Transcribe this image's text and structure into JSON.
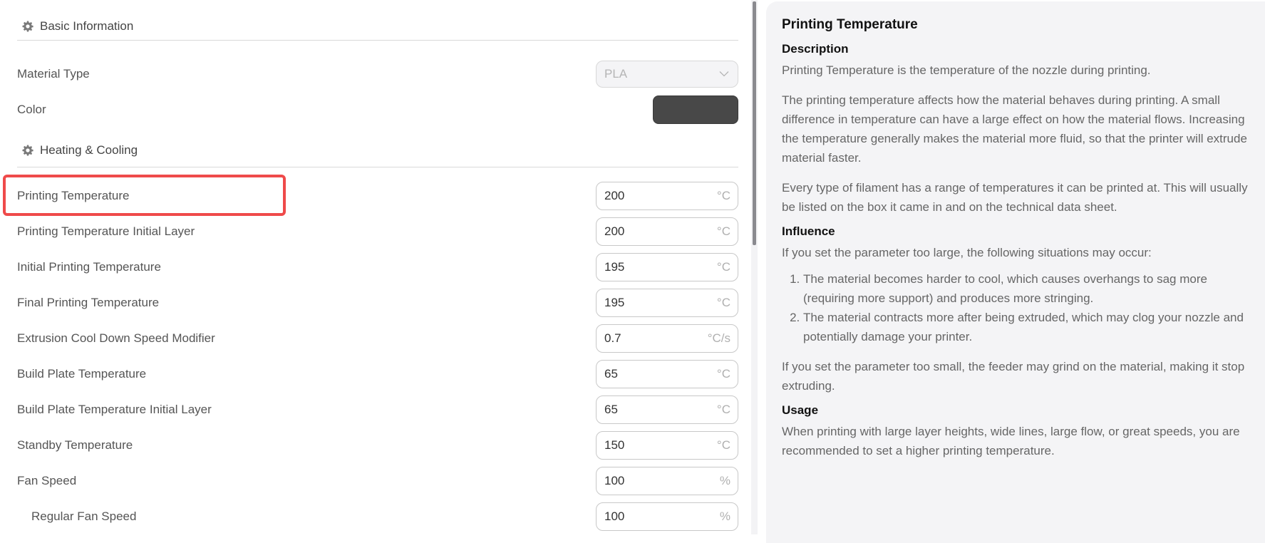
{
  "sections": [
    {
      "title": "Basic Information",
      "icon": "gear-icon"
    },
    {
      "title": "Heating & Cooling",
      "icon": "gear-icon"
    }
  ],
  "basic": {
    "material_type": {
      "label": "Material Type",
      "value": "PLA",
      "disabled": true
    },
    "color": {
      "label": "Color",
      "value": "#484848"
    }
  },
  "settings": [
    {
      "label": "Printing Temperature",
      "value": "200",
      "unit": "°C",
      "highlighted": true
    },
    {
      "label": "Printing Temperature Initial Layer",
      "value": "200",
      "unit": "°C"
    },
    {
      "label": "Initial Printing Temperature",
      "value": "195",
      "unit": "°C"
    },
    {
      "label": "Final Printing Temperature",
      "value": "195",
      "unit": "°C"
    },
    {
      "label": "Extrusion Cool Down Speed Modifier",
      "value": "0.7",
      "unit": "°C/s"
    },
    {
      "label": "Build Plate Temperature",
      "value": "65",
      "unit": "°C"
    },
    {
      "label": "Build Plate Temperature Initial Layer",
      "value": "65",
      "unit": "°C"
    },
    {
      "label": "Standby Temperature",
      "value": "150",
      "unit": "°C"
    },
    {
      "label": "Fan Speed",
      "value": "100",
      "unit": "%"
    },
    {
      "label": "Regular Fan Speed",
      "value": "100",
      "unit": "%",
      "indented": true
    }
  ],
  "highlight_color": "#ef4a4a",
  "help": {
    "title": "Printing Temperature",
    "description_heading": "Description",
    "description": [
      "Printing Temperature is the temperature of the nozzle during printing.",
      "The printing temperature affects how the material behaves during printing. A small difference in temperature can have a large effect on how the material flows. Increasing the temperature generally makes the material more fluid, so that the printer will extrude material faster.",
      "Every type of filament has a range of temperatures it can be printed at. This will usually be listed on the box it came in and on the technical data sheet."
    ],
    "influence_heading": "Influence",
    "influence_intro": "If you set the parameter too large, the following situations may occur:",
    "influence_list": [
      "The material becomes harder to cool, which causes overhangs to sag more (requiring more support) and produces more stringing.",
      "The material contracts more after being extruded, which may clog your nozzle and potentially damage your printer."
    ],
    "influence_small": "If you set the parameter too small, the feeder may grind on the material, making it stop extruding.",
    "usage_heading": "Usage",
    "usage": "When printing with large layer heights, wide lines, large flow, or great speeds, you are recommended to set a higher printing temperature."
  }
}
